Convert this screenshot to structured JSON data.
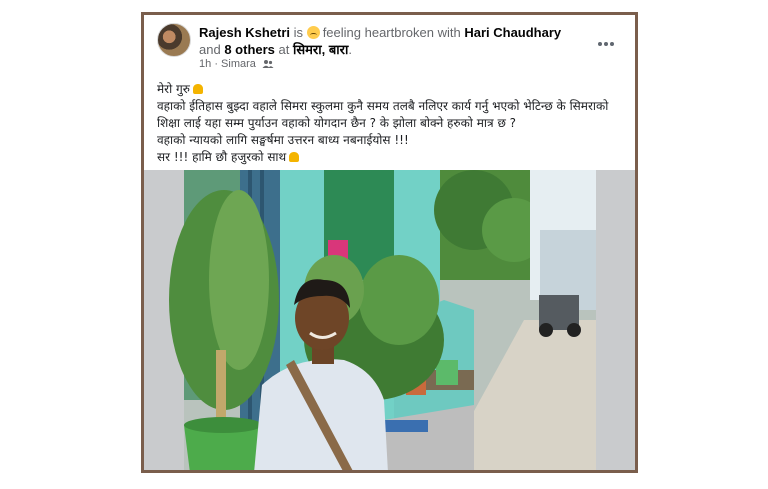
{
  "post": {
    "author": "Rajesh Kshetri",
    "is_text": "is",
    "feeling": "feeling heartbroken with",
    "tagged": "Hari Chaudhary",
    "and_text": "and",
    "others": "8 others",
    "at_text": "at",
    "location": "सिमरा, बारा",
    "period": ".",
    "time": "1h",
    "sep": "·",
    "place": "Simara",
    "text_lines": [
      "मेरो गुरु",
      "वहाको ईतिहास बुझ्दा वहाले सिमरा स्कुलमा कुनै समय तलबै नलिएर कार्य गर्नु भएको भेटिन्छ के सिमराको शिक्षा लाई यहा सम्म पुर्याउन वहाको योगदान छैन ? के झोला बोक्ने हरुको मात्र छ ?",
      "वहाको न्यायको लागि सङ्घर्षमा उत्तरन बाध्य नबनाईयोस !!!",
      "सर !!! हामि छौ हजुरको साथ"
    ]
  },
  "icons": {
    "avatar": "profile-photo",
    "feeling": "sad-face-emoji",
    "audience": "friends-icon",
    "more": "more-horizontal-icon",
    "prayer": "folded-hands-emoji"
  },
  "colors": {
    "frame_border": "#7a5e4c",
    "name": "#050505",
    "secondary_text": "#65676b"
  }
}
